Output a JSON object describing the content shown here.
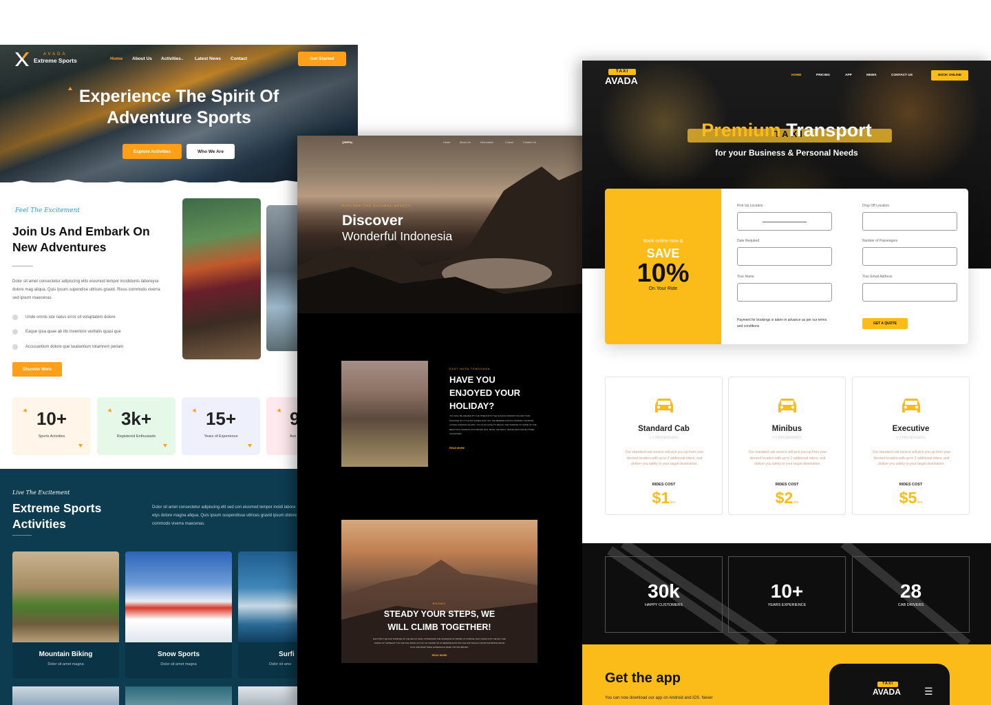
{
  "colors": {
    "extreme_accent": "#ff9f1a",
    "extreme_dark": "#0d3c50",
    "indonesia_accent": "#ffb020",
    "taxi_accent": "#fbbc1a"
  },
  "extreme": {
    "logo_small": "AVADA",
    "logo_big": "Extreme Sports",
    "nav": [
      "Home",
      "About Us",
      "Activities",
      "Latest News",
      "Contact"
    ],
    "cta_top": "Get Started",
    "hero_line1": "Experience The Spirit Of",
    "hero_line2": "Adventure Sports",
    "btn_explore": "Explore Activities",
    "btn_who": "Who We Are",
    "script1": "Feel The Excitement",
    "heading1": "Join Us And Embark On",
    "heading2": "New Adventures",
    "body": "Dolor sit amet consectetur adipiscing elits eiusmod tempor incididunts laboreyse dolore mag aliqua. Quis ipsum supendise ultrices gravid. Rixus commodo viverra sed ipsum maecenas",
    "checks": [
      "Unde omnis iste natus error sit voluptatem dolore",
      "Eaque ipsa quae ab illo inventore veritatis quasi que",
      "Accusantium dolore que laudantium totamrem periam"
    ],
    "btn_discover": "Discover More",
    "stats": [
      {
        "num": "10+",
        "label": "Sports Activities"
      },
      {
        "num": "3k+",
        "label": "Registered Enthusiasts"
      },
      {
        "num": "15+",
        "label": "Years of Experience"
      },
      {
        "num": "9",
        "label": "Ave"
      }
    ],
    "script2": "Live The Excitement",
    "section_title1": "Extreme Sports",
    "section_title2": "Activities",
    "section_body": "Dolor sit amet consectetur adipiscing elit sed con eiusmod tempor incidi labore etys dolore magna aliqua. Quis ipsum suspendisse ultrices gravid ipsum dolore commodo viverra maecenas.",
    "cards": [
      {
        "title": "Mountain Biking",
        "sub": "Dolor sit amet magna"
      },
      {
        "title": "Snow Sports",
        "sub": "Dolor sit amet magna"
      },
      {
        "title": "Surfi",
        "sub": "Dolor sit ame"
      }
    ]
  },
  "indonesia": {
    "brand": "QWERty",
    "nav": [
      "Home",
      "About Us",
      "Information",
      "Culture",
      "Contact Us"
    ],
    "kicker": "EXPLORE THE NATURAL BEAUTY",
    "title1": "Discover",
    "title2": "Wonderful Indonesia",
    "s1_kicker": "EAST NUSA TENGGARA",
    "s1_title": [
      "HAVE YOU",
      "ENJOYED YOUR",
      "HOLIDAY?"
    ],
    "s1_body": "YOU WILL BE AMAZED BY THE TREETOP IN THE SAILING KOMODO ISLAND TOUR PACKAGE SO IT'S ALSO NAMED FOR YOU THE BEREDE SAILING KOMODO TOURISM LOVING KOMODO ISLAND. YOU ALSO HAVE TO REACH THE SUNRISE TO SOME OF THE BEAUTIFUL WATERS OF KOMODO WILL MAKE THE MANY TRAVELLERS FROM OTHER COUNTRIES.",
    "s1_link": "READ MORE",
    "s2_kicker": "BROMO",
    "s2_title1": "STEADY YOUR STEPS, WE",
    "s2_title2": "WILL CLIMB TOGETHER!",
    "s2_body": "ENJOYING THE VAST EXPANSE OF THE SEA OF SAND, WITNESSING THE SPLENDOR OF BROMO AT SUNRISE THAT SOARS INTO THE SKY, AND GAZING AT THE BEAUTY OF THE SUN RISING OUT OF ITS CRATER OR OTHERWISE ENJOYING THE DIM TWILIGHT FROM THE BROMO RIDGE IS AN UNFORGETTABLE EXPERIENCE WHEN VISITING BROMO.",
    "s2_link": "READ MORE"
  },
  "taxi": {
    "logo_top": "TAXI",
    "logo_bottom": "AVADA",
    "nav": [
      "HOME",
      "PRICING",
      "APP",
      "NEWS",
      "CONTACT US"
    ],
    "btn_book": "BOOK ONLINE",
    "hero_accent": "Premium",
    "hero_rest": "Transport",
    "hero_sub": "for your Business & Personal Needs",
    "promo": {
      "line1": "Book online now &",
      "save": "SAVE",
      "pct": "10%",
      "line2": "On Your Ride"
    },
    "labels": {
      "pickup": "Pick Up Location",
      "dropoff": "Drop Off Location",
      "date": "Date Required",
      "passengers": "Number of Passengers",
      "name": "Your Name",
      "email": "Your Email Address"
    },
    "terms": "Payment for bookings is taken in advance as per our terms and conditions",
    "quote_btn": "GET A QUOTE",
    "services": [
      {
        "title": "Standard Cab",
        "pax": "1-3 PASSENGERS",
        "desc": "Our standard cab service will pick you up from your desired location with up to 2 additional riders, and deliver you safely to your target destination.",
        "cost_label": "RIDES COST",
        "price": "$1",
        "unit": "/km"
      },
      {
        "title": "Minibus",
        "pax": "1-6 PASSENGERS",
        "desc": "Our standard cab service will pick you up from your desired location with up to 2 additional riders, and deliver you safely to your target destination.",
        "cost_label": "RIDES COST",
        "price": "$2",
        "unit": "/km"
      },
      {
        "title": "Executive",
        "pax": "1-3 PASSENGERS",
        "desc": "Our standard cab service will pick you up from your desired location with up to 2 additional riders, and deliver you safely to your target destination.",
        "cost_label": "RIDES COST",
        "price": "$5",
        "unit": "/km"
      }
    ],
    "counters": [
      {
        "num": "30k",
        "label": "HAPPY CUSTOMERS"
      },
      {
        "num": "10+",
        "label": "YEARS EXPERIENCE"
      },
      {
        "num": "28",
        "label": "CAB DRIVERS"
      }
    ],
    "app_title": "Get the app",
    "app_body": "You can now download our app on Android and iOS. Never",
    "phone_logo_top": "TAXI",
    "phone_logo_bottom": "AVADA"
  }
}
